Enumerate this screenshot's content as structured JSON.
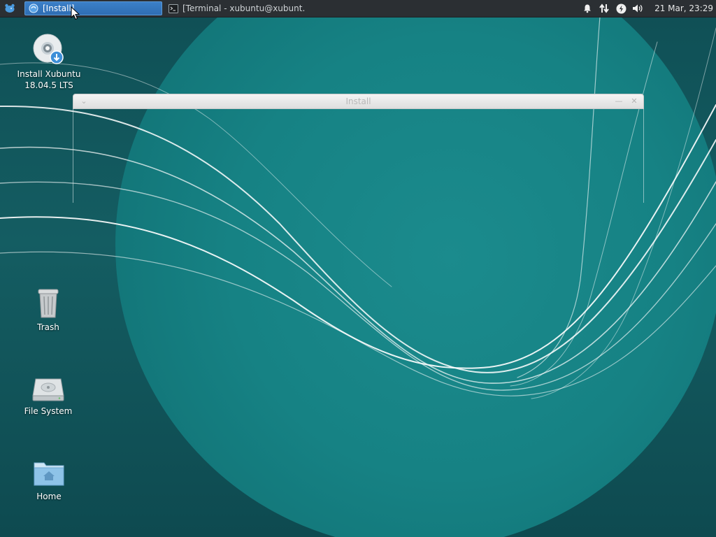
{
  "panel": {
    "menu_icon": "xubuntu-mouse-icon",
    "tasks": [
      {
        "label": "[Install]",
        "icon": "installer-icon",
        "active": true
      },
      {
        "label": "[Terminal - xubuntu@xubunt...",
        "icon": "terminal-icon",
        "active": false
      }
    ],
    "tray_icons": [
      "notification-bell-icon",
      "network-arrows-icon",
      "power-icon",
      "volume-icon"
    ],
    "clock": "21 Mar, 23:29"
  },
  "desktop": {
    "icons": [
      {
        "label": "Install Xubuntu\n18.04.5 LTS",
        "line1": "Install Xubuntu",
        "line2": "18.04.5 LTS",
        "icon": "install-disc-icon"
      },
      {
        "label": "Trash",
        "icon": "trash-icon"
      },
      {
        "label": "File System",
        "icon": "hard-drive-icon"
      },
      {
        "label": "Home",
        "icon": "home-folder-icon"
      }
    ]
  },
  "install_window": {
    "title": "Install",
    "controls": [
      "menu",
      "minimize",
      "close"
    ]
  },
  "colors": {
    "accent": "#3b7fc8",
    "panel_bg": "#2b2f33",
    "wallpaper_circle": "#1a8a8c",
    "wallpaper_bg": "#0f4f55"
  }
}
